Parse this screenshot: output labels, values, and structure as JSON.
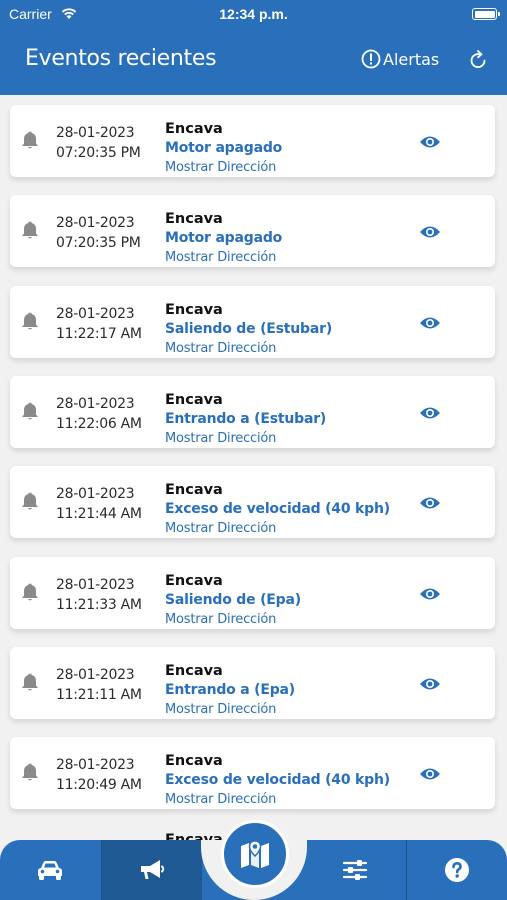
{
  "status_bar": {
    "carrier": "Carrier",
    "time": "12:34 p.m."
  },
  "header": {
    "title": "Eventos recientes",
    "alerts_label": "Alertas"
  },
  "events": [
    {
      "date": "28-01-2023",
      "time": "07:20:35 PM",
      "vehicle": "Encava",
      "event": "Motor apagado",
      "address_link": "Mostrar Dirección"
    },
    {
      "date": "28-01-2023",
      "time": "07:20:35 PM",
      "vehicle": "Encava",
      "event": "Motor apagado",
      "address_link": "Mostrar Dirección"
    },
    {
      "date": "28-01-2023",
      "time": "11:22:17 AM",
      "vehicle": "Encava",
      "event": "Saliendo de (Estubar)",
      "address_link": "Mostrar Dirección"
    },
    {
      "date": "28-01-2023",
      "time": "11:22:06 AM",
      "vehicle": "Encava",
      "event": "Entrando a (Estubar)",
      "address_link": "Mostrar Dirección"
    },
    {
      "date": "28-01-2023",
      "time": "11:21:44 AM",
      "vehicle": "Encava",
      "event": "Exceso de velocidad (40 kph)",
      "address_link": "Mostrar Dirección"
    },
    {
      "date": "28-01-2023",
      "time": "11:21:33 AM",
      "vehicle": "Encava",
      "event": "Saliendo de (Epa)",
      "address_link": "Mostrar Dirección"
    },
    {
      "date": "28-01-2023",
      "time": "11:21:11 AM",
      "vehicle": "Encava",
      "event": "Entrando a (Epa)",
      "address_link": "Mostrar Dirección"
    },
    {
      "date": "28-01-2023",
      "time": "11:20:49 AM",
      "vehicle": "Encava",
      "event": "Exceso de velocidad (40 kph)",
      "address_link": "Mostrar Dirección"
    }
  ],
  "partial_row_vehicle": "Encava",
  "tabbar": {
    "tabs": [
      {
        "icon": "car-icon"
      },
      {
        "icon": "megaphone-icon",
        "active": true
      },
      {
        "icon": "map-icon"
      },
      {
        "icon": "sliders-icon"
      },
      {
        "icon": "help-icon"
      }
    ]
  },
  "colors": {
    "primary": "#2a6fba",
    "active_tab": "#1e5994",
    "background": "#f1f1f1"
  }
}
